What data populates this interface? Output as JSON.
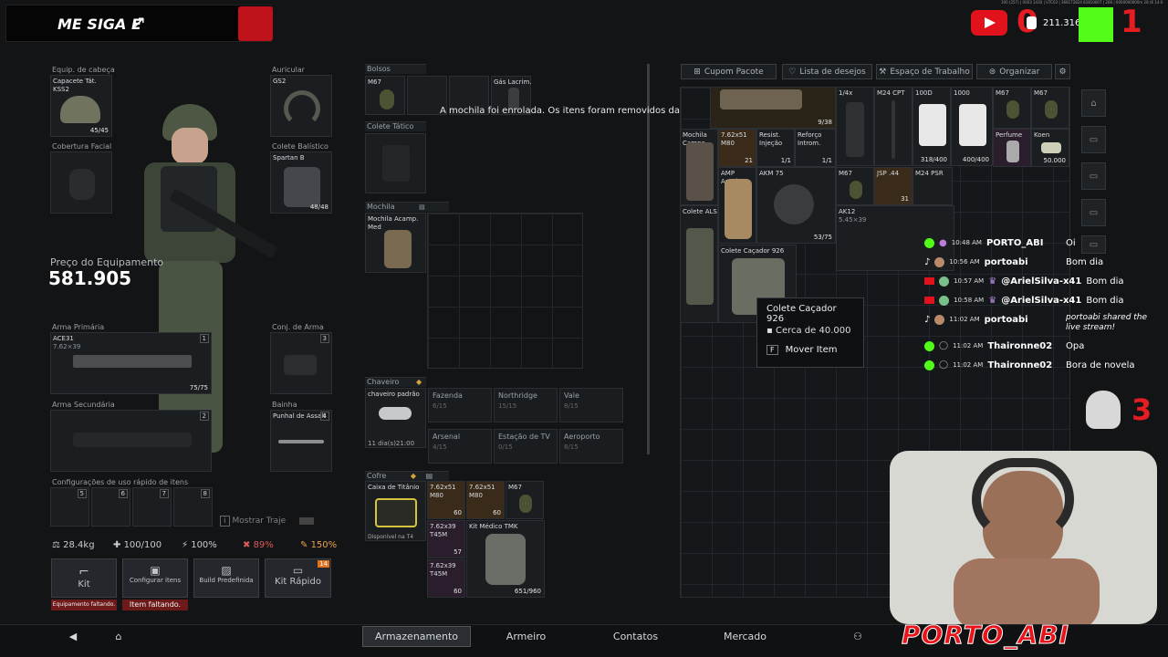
{
  "overlay": {
    "banner_text": "ME SIGA E",
    "counter_text": "211.316",
    "score_left": "0",
    "score_right": "1",
    "kill_count": "3",
    "channel_brand": "PORTO_ABI",
    "top_tiny_text": "100 (257) | 0003 1430 | UTC03 | 368172824 81810007 | 266 | 0000000000m 28 (K 14-0"
  },
  "equipment": {
    "head": {
      "label": "Equip. de cabeça",
      "name": "Capacete Tát.\nKSS2",
      "count": "45/45"
    },
    "ear": {
      "label": "Auricular",
      "name": "GS2"
    },
    "face": {
      "label": "Cobertura Facial"
    },
    "vest": {
      "label": "Colete Balístico",
      "name": "Spartan B",
      "count": "48/48"
    },
    "price_label": "Preço do Equipamento",
    "price_value": "581.905",
    "primary": {
      "label": "Arma Primária",
      "name": "ACE31",
      "caliber": "7.62×39",
      "count": "75/75",
      "slot": "1"
    },
    "secondary": {
      "label": "Arma Secundária",
      "slot": "2"
    },
    "sidearm": {
      "label": "Conj. de Arma",
      "slot": "3"
    },
    "sheath": {
      "label": "Bainha",
      "name": "Punhal de Assalt",
      "slot": "4"
    },
    "quick_label": "Configurações de uso rápido de itens",
    "quick_slots": [
      "5",
      "6",
      "7",
      "8"
    ],
    "show_outfit": "Mostrar Traje"
  },
  "stats": {
    "weight": "28.4kg",
    "health": "100/100",
    "stamina": "100%",
    "hydration": "89%",
    "energy": "150%"
  },
  "bottom_buttons": {
    "kit": "Kit",
    "kit_warn": "Equipamento faltando.",
    "config": "Configurar itens",
    "config_warn": "Item faltando.",
    "build": "Build Predefinida",
    "quick_kit": "Kit Rápido",
    "quick_kit_badge": "14"
  },
  "containers": {
    "pockets": {
      "label": "Bolsos",
      "item1": "M67",
      "item4": "Gás Lacrim."
    },
    "rig": {
      "label": "Colete Tático"
    },
    "backpack": {
      "label": "Mochila",
      "item": "Mochila Acamp.\nMed"
    },
    "keychain": {
      "label": "Chaveiro",
      "item": "chaveiro padrão",
      "timer": "11 dia(s)21:00"
    },
    "maps": [
      {
        "name": "Fazenda",
        "count": "6/15"
      },
      {
        "name": "Northridge",
        "count": "15/15"
      },
      {
        "name": "Vale",
        "count": "8/15"
      },
      {
        "name": "Arsenal",
        "count": "4/15"
      },
      {
        "name": "Estação de TV",
        "count": "0/15"
      },
      {
        "name": "Aeroporto",
        "count": "8/15"
      }
    ],
    "safe": {
      "label": "Cofre",
      "item": "Caixa de Titânio",
      "available": "Disponível na T4",
      "items": [
        {
          "name": "7.62x51\nM80",
          "count": "60"
        },
        {
          "name": "7.62x51\nM80",
          "count": "60"
        },
        {
          "name": "M67",
          "count": ""
        },
        {
          "name": "7.62x39\nT45M",
          "count": "57"
        },
        {
          "name": "7.62x39\nT45M",
          "count": "60"
        }
      ],
      "medkit": {
        "name": "Kit Médico TMK",
        "count": "651/960"
      }
    }
  },
  "notification": "A mochila foi enrolada. Os itens foram removidos da mochila.",
  "storage_tabs": {
    "coupon": "Cupom Pacote",
    "wishlist": "Lista de desejos",
    "workspace": "Espaço de Trabalho",
    "organize": "Organizar"
  },
  "storage_items": [
    {
      "name": "",
      "count": "9/38"
    },
    {
      "name": "1/4x",
      "count": ""
    },
    {
      "name": "M24 CPT",
      "count": ""
    },
    {
      "name": "100D",
      "count": "318/400"
    },
    {
      "name": "1000",
      "count": "400/400"
    },
    {
      "name": "M67",
      "count": ""
    },
    {
      "name": "M67",
      "count": ""
    },
    {
      "name": "Mochila\nCampo",
      "count": ""
    },
    {
      "name": "7.62x51\nM80",
      "count": "21"
    },
    {
      "name": "Resist.\nInjeção",
      "count": "1/1"
    },
    {
      "name": "Reforço\nIntrom.",
      "count": "1/1"
    },
    {
      "name": "Perfume",
      "count": ""
    },
    {
      "name": "Koen",
      "count": "50.000"
    },
    {
      "name": "AMP\nAssalto",
      "count": ""
    },
    {
      "name": "AKM 75",
      "count": "53/75"
    },
    {
      "name": "M67",
      "count": ""
    },
    {
      "name": "JSP .44",
      "count": "31"
    },
    {
      "name": "M24 PSR",
      "count": ""
    },
    {
      "name": "Colete ALS",
      "count": ""
    },
    {
      "name": "AK12",
      "count": "5.45×39"
    },
    {
      "name": "Colete Caçador 926",
      "count": ""
    }
  ],
  "tooltip": {
    "title": "Colete Caçador 926",
    "price": "Cerca de 40.000",
    "key": "F",
    "action": "Mover Item"
  },
  "chat": [
    {
      "time": "10:48 AM",
      "user": "PORTO_ABI",
      "msg": "Oi"
    },
    {
      "time": "10:56 AM",
      "user": "portoabi",
      "msg": "Bom dia"
    },
    {
      "time": "10:57 AM",
      "user": "@ArielSilva-x41",
      "msg": "Bom dia"
    },
    {
      "time": "10:58 AM",
      "user": "@ArielSilva-x41",
      "msg": "Bom dia"
    },
    {
      "time": "11:02 AM",
      "user": "portoabi",
      "msg": "portoabi shared the live stream!"
    },
    {
      "time": "11:02 AM",
      "user": "Thaironne02",
      "msg": "Opa"
    },
    {
      "time": "11:02 AM",
      "user": "Thaironne02",
      "msg": "Bora de novela"
    }
  ],
  "nav": {
    "storage": "Armazenamento",
    "armory": "Armeiro",
    "contacts": "Contatos",
    "market": "Mercado"
  }
}
